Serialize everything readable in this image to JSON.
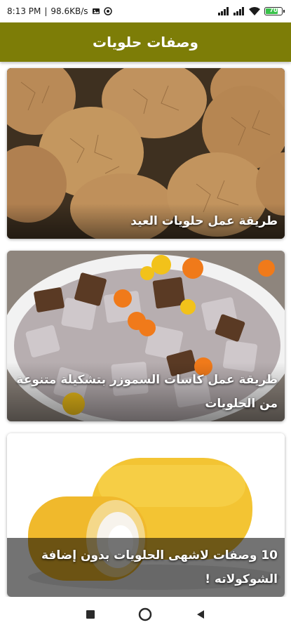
{
  "status_bar": {
    "time": "8:13 PM",
    "speed": "98.6KB/s",
    "battery": "70"
  },
  "app_bar": {
    "title": "وصفات حلويات"
  },
  "recipes": [
    {
      "title": "طريقة عمل حلويات العيد",
      "image": "ginger-cookies"
    },
    {
      "title": "طريقة عمل كاسات السموزر بتشكيلة متنوعة من الحلويات",
      "image": "puppy-chow-snack-bowl"
    },
    {
      "title": "10 وصفات لاشهى الحلويات بدون إضافة الشوكولاته !",
      "image": "cream-filled-sponge-cakes"
    }
  ],
  "colors": {
    "app_bar": "#7d7d07",
    "title_text": "#ffffff"
  },
  "icons": [
    "image-icon",
    "settings-icon",
    "signal-icon",
    "wifi-icon",
    "battery-icon",
    "recent-apps-icon",
    "home-icon",
    "back-icon"
  ]
}
